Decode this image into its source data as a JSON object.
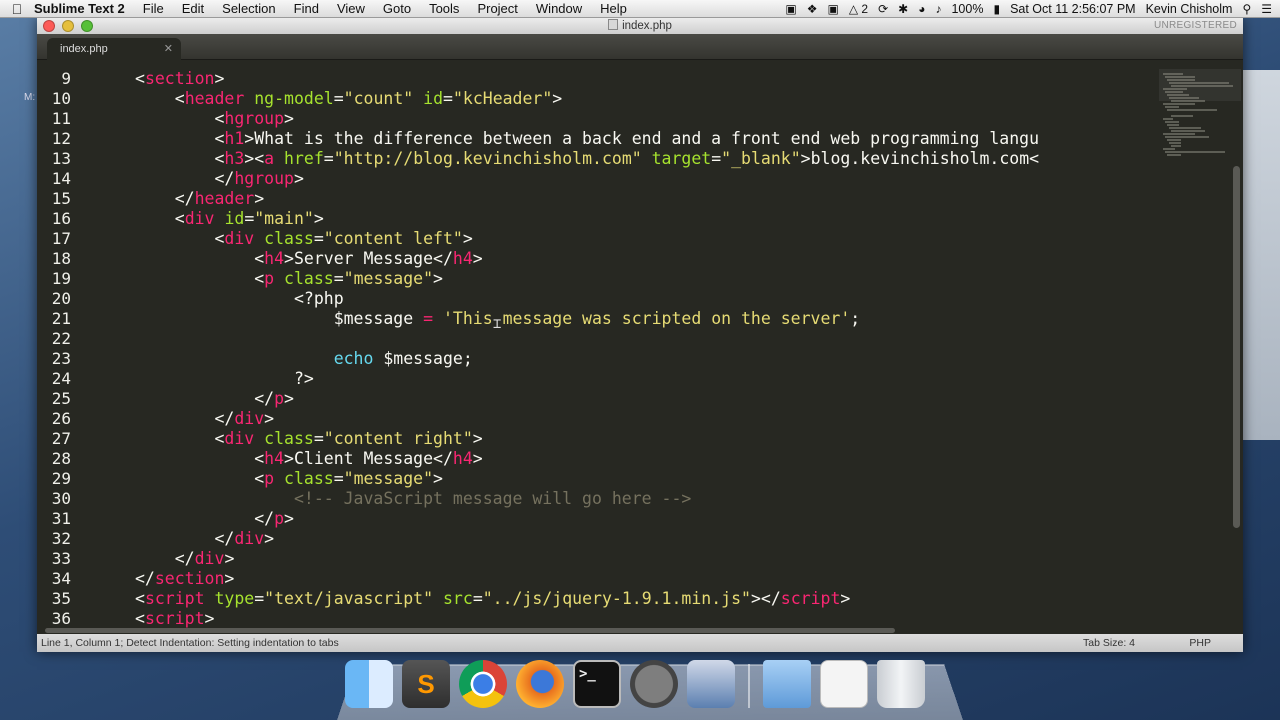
{
  "menubar": {
    "app_name": "Sublime Text 2",
    "menus": [
      "File",
      "Edit",
      "Selection",
      "Find",
      "View",
      "Goto",
      "Tools",
      "Project",
      "Window",
      "Help"
    ],
    "battery": "100%",
    "clock": "Sat Oct 11  2:56:07 PM",
    "user": "Kevin Chisholm",
    "adobe_badge": "2"
  },
  "window": {
    "title": "index.php",
    "unregistered": "UNREGISTERED",
    "tab_label": "index.php"
  },
  "editor": {
    "lines": [
      {
        "n": "9",
        "html": "<span class='pl'>&lt;</span><span class='tg'>section</span><span class='pl'>&gt;</span>",
        "indent": 0
      },
      {
        "n": "10",
        "html": "    <span class='pl'>&lt;</span><span class='tg'>header</span> <span class='at'>ng-model</span><span class='pl'>=</span><span class='st'>\"count\"</span> <span class='at'>id</span><span class='pl'>=</span><span class='st'>\"kcHeader\"</span><span class='pl'>&gt;</span>"
      },
      {
        "n": "11",
        "html": "        <span class='pl'>&lt;</span><span class='tg'>hgroup</span><span class='pl'>&gt;</span>"
      },
      {
        "n": "12",
        "html": "        <span class='pl'>&lt;</span><span class='tg'>h1</span><span class='pl'>&gt;What is the difference between a back end and a front end web programming langu</span>"
      },
      {
        "n": "13",
        "html": "        <span class='pl'>&lt;</span><span class='tg'>h3</span><span class='pl'>&gt;&lt;</span><span class='tg'>a</span> <span class='at'>href</span><span class='pl'>=</span><span class='st'>\"http://blog.kevinchisholm.com\"</span> <span class='at'>target</span><span class='pl'>=</span><span class='st'>\"_blank\"</span><span class='pl'>&gt;blog.kevinchisholm.com&lt;</span>"
      },
      {
        "n": "14",
        "html": "        <span class='pl'>&lt;/</span><span class='tg'>hgroup</span><span class='pl'>&gt;</span>"
      },
      {
        "n": "15",
        "html": "    <span class='pl'>&lt;/</span><span class='tg'>header</span><span class='pl'>&gt;</span>"
      },
      {
        "n": "16",
        "html": "    <span class='pl'>&lt;</span><span class='tg'>div</span> <span class='at'>id</span><span class='pl'>=</span><span class='st'>\"main\"</span><span class='pl'>&gt;</span>"
      },
      {
        "n": "17",
        "html": "        <span class='pl'>&lt;</span><span class='tg'>div</span> <span class='at'>class</span><span class='pl'>=</span><span class='st'>\"content left\"</span><span class='pl'>&gt;</span>"
      },
      {
        "n": "18",
        "html": "            <span class='pl'>&lt;</span><span class='tg'>h4</span><span class='pl'>&gt;Server Message&lt;/</span><span class='tg'>h4</span><span class='pl'>&gt;</span>"
      },
      {
        "n": "19",
        "html": "            <span class='pl'>&lt;</span><span class='tg'>p</span> <span class='at'>class</span><span class='pl'>=</span><span class='st'>\"message\"</span><span class='pl'>&gt;</span>"
      },
      {
        "n": "20",
        "html": "                <span class='pl'>&lt;?php</span>"
      },
      {
        "n": "21",
        "html": "                    <span class='pl'>$message</span> <span class='tg'>=</span> <span class='st'>'This message was scripted on the server'</span><span class='pl'>;</span>"
      },
      {
        "n": "22",
        "html": ""
      },
      {
        "n": "23",
        "html": "                    <span class='kw'>echo</span> <span class='pl'>$message;</span>"
      },
      {
        "n": "24",
        "html": "                <span class='pl'>?&gt;</span>"
      },
      {
        "n": "25",
        "html": "            <span class='pl'>&lt;/</span><span class='tg'>p</span><span class='pl'>&gt;</span>"
      },
      {
        "n": "26",
        "html": "        <span class='pl'>&lt;/</span><span class='tg'>div</span><span class='pl'>&gt;</span>"
      },
      {
        "n": "27",
        "html": "        <span class='pl'>&lt;</span><span class='tg'>div</span> <span class='at'>class</span><span class='pl'>=</span><span class='st'>\"content right\"</span><span class='pl'>&gt;</span>"
      },
      {
        "n": "28",
        "html": "            <span class='pl'>&lt;</span><span class='tg'>h4</span><span class='pl'>&gt;Client Message&lt;/</span><span class='tg'>h4</span><span class='pl'>&gt;</span>"
      },
      {
        "n": "29",
        "html": "            <span class='pl'>&lt;</span><span class='tg'>p</span> <span class='at'>class</span><span class='pl'>=</span><span class='st'>\"message\"</span><span class='pl'>&gt;</span>"
      },
      {
        "n": "30",
        "html": "                <span class='cm'>&lt;!-- JavaScript message will go here --&gt;</span>"
      },
      {
        "n": "31",
        "html": "            <span class='pl'>&lt;/</span><span class='tg'>p</span><span class='pl'>&gt;</span>"
      },
      {
        "n": "32",
        "html": "        <span class='pl'>&lt;/</span><span class='tg'>div</span><span class='pl'>&gt;</span>"
      },
      {
        "n": "33",
        "html": "    <span class='pl'>&lt;/</span><span class='tg'>div</span><span class='pl'>&gt;</span>"
      },
      {
        "n": "34",
        "html": "<span class='pl'>&lt;/</span><span class='tg'>section</span><span class='pl'>&gt;</span>"
      },
      {
        "n": "35",
        "html": "<span class='pl'>&lt;</span><span class='tg'>script</span> <span class='at'>type</span><span class='pl'>=</span><span class='st'>\"text/javascript\"</span> <span class='at'>src</span><span class='pl'>=</span><span class='st'>\"../js/jquery-1.9.1.min.js\"</span><span class='pl'>&gt;&lt;/</span><span class='tg'>script</span><span class='pl'>&gt;</span>"
      },
      {
        "n": "36",
        "html": "<span class='pl'>&lt;</span><span class='tg'>script</span><span class='pl'>&gt;</span>"
      }
    ]
  },
  "statusbar": {
    "left": "Line 1, Column 1; Detect Indentation: Setting indentation to tabs",
    "tab_size": "Tab Size: 4",
    "syntax": "PHP"
  },
  "dock": {
    "items": [
      {
        "name": "finder-icon"
      },
      {
        "name": "sublime-text-icon",
        "glyph": "S"
      },
      {
        "name": "chrome-icon"
      },
      {
        "name": "firefox-icon"
      },
      {
        "name": "terminal-icon",
        "glyph": ">_"
      },
      {
        "name": "mamp-icon"
      },
      {
        "name": "video-icon"
      },
      {
        "name": "folder-icon"
      },
      {
        "name": "documents-icon"
      },
      {
        "name": "trash-icon"
      }
    ]
  },
  "colors": {
    "editor_bg": "#272822",
    "tag": "#f92672",
    "attribute": "#a6e22e",
    "string": "#e6db74",
    "comment": "#75715e",
    "keyword": "#66d9ef"
  }
}
